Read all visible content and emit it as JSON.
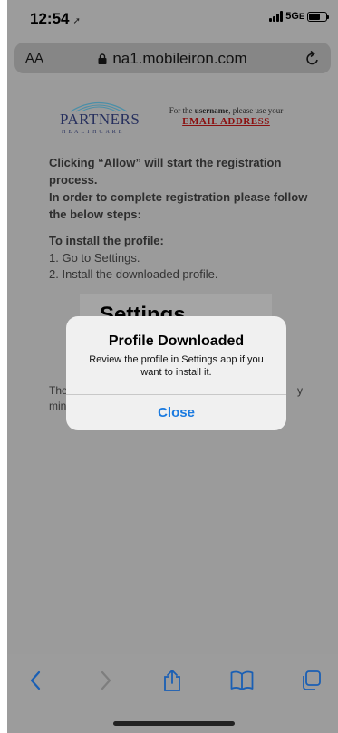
{
  "status": {
    "time": "12:54",
    "network": "5G",
    "network_suffix": "E"
  },
  "browser": {
    "text_size_label": "AA",
    "url": "na1.mobileiron.com"
  },
  "page": {
    "logo_text": "PARTNERS",
    "logo_subtext": "HEALTHCARE",
    "username_note_prefix": "For the",
    "username_note_bold": "username",
    "username_note_suffix": ", please use your",
    "email_link": "EMAIL ADDRESS",
    "intro_line1": "Clicking “Allow” will start the registration process.",
    "intro_line2": "In order to complete registration please follow the below steps:",
    "install_heading": "To install the profile:",
    "step1": "1. Go to Settings.",
    "step2": "2. Install the downloaded profile.",
    "settings_title": "Settings",
    "fragment_the": "The",
    "fragment_min": "min",
    "fragment_y": "y"
  },
  "alert": {
    "title": "Profile Downloaded",
    "message": "Review the profile in Settings app if you want to install it.",
    "close_label": "Close"
  },
  "toolbar": {
    "icons": [
      "back-icon",
      "forward-icon",
      "share-icon",
      "bookmarks-icon",
      "tabs-icon"
    ]
  },
  "colors": {
    "accent": "#1a7ae0",
    "email_link": "#8b0f0f",
    "logo": "#27305e"
  }
}
